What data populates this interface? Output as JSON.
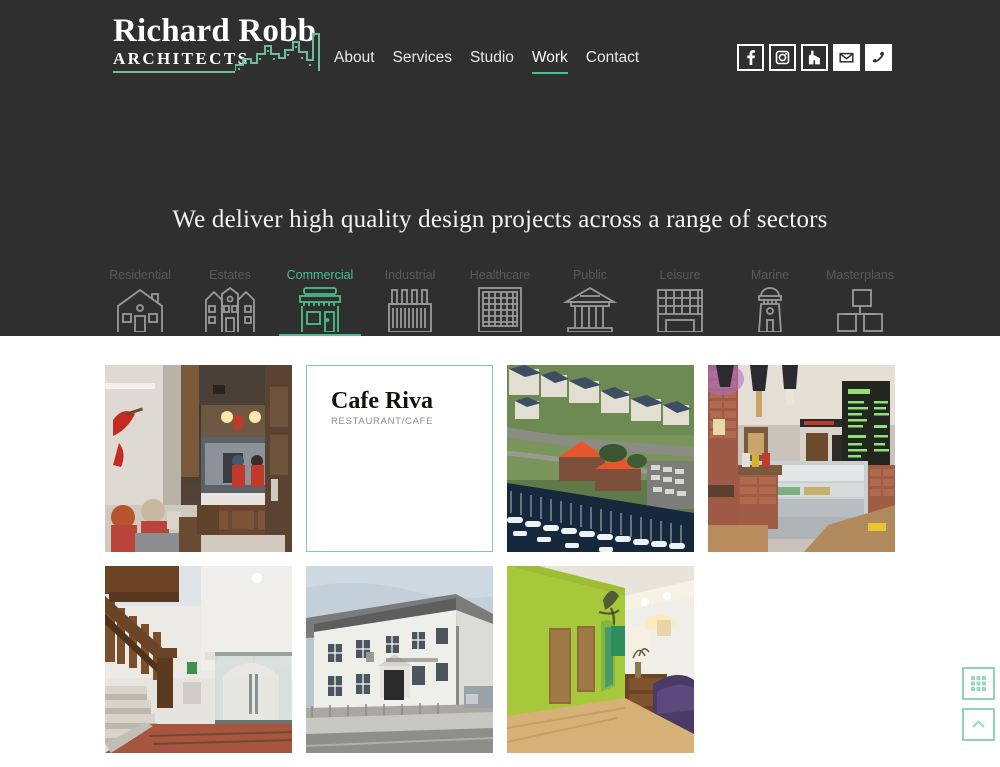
{
  "site": {
    "brand_name": "Richard Robb",
    "brand_sub": "ARCHITECTS",
    "accent_green": "#4bbf8c",
    "header_bg": "#2f2f2f",
    "card_border": "#7ec9ad"
  },
  "nav": {
    "items": [
      {
        "label": "About",
        "active": false
      },
      {
        "label": "Services",
        "active": false
      },
      {
        "label": "Studio",
        "active": false
      },
      {
        "label": "Work",
        "active": true
      },
      {
        "label": "Contact",
        "active": false
      }
    ]
  },
  "social": {
    "items": [
      {
        "name": "facebook-icon",
        "style": "dark"
      },
      {
        "name": "instagram-icon",
        "style": "dark"
      },
      {
        "name": "houzz-icon",
        "style": "dark"
      },
      {
        "name": "email-icon",
        "style": "light"
      },
      {
        "name": "phone-icon",
        "style": "light"
      }
    ]
  },
  "hero": {
    "tagline": "We deliver high quality design projects across a range of sectors"
  },
  "sectors": {
    "items": [
      {
        "label": "Residential",
        "icon": "house-icon",
        "active": false
      },
      {
        "label": "Estates",
        "icon": "estate-icon",
        "active": false
      },
      {
        "label": "Commercial",
        "icon": "shop-icon",
        "active": true
      },
      {
        "label": "Industrial",
        "icon": "factory-icon",
        "active": false
      },
      {
        "label": "Healthcare",
        "icon": "hospital-icon",
        "active": false
      },
      {
        "label": "Public",
        "icon": "civic-icon",
        "active": false
      },
      {
        "label": "Leisure",
        "icon": "leisure-icon",
        "active": false
      },
      {
        "label": "Marine",
        "icon": "lighthouse-icon",
        "active": false
      },
      {
        "label": "Masterplans",
        "icon": "masterplan-icon",
        "active": false
      }
    ]
  },
  "projects": {
    "items": [
      {
        "type": "photo",
        "photo": "cafe-bar-interior",
        "alt": "Cafe bar interior with counter and seated customers"
      },
      {
        "type": "card",
        "title": "Cafe Riva",
        "subtitle": "RESTAURANT/CAFE"
      },
      {
        "type": "photo",
        "photo": "marina-aerial",
        "alt": "Aerial view of marina with orange roofed buildings"
      },
      {
        "type": "photo",
        "photo": "deli-counter",
        "alt": "Cafe deli counter with chalkboard menu"
      },
      {
        "type": "photo",
        "photo": "stair-hall",
        "alt": "Timber staircase hall with glazed doors"
      },
      {
        "type": "photo",
        "photo": "white-building",
        "alt": "White rendered two storey building on street"
      },
      {
        "type": "photo",
        "photo": "green-corridor",
        "alt": "Green walled corridor with purple armchair"
      }
    ]
  },
  "floating": {
    "buttons": [
      {
        "name": "grid-view-button",
        "icon": "grid-icon"
      },
      {
        "name": "back-to-top-button",
        "icon": "chevron-up-icon"
      }
    ]
  }
}
